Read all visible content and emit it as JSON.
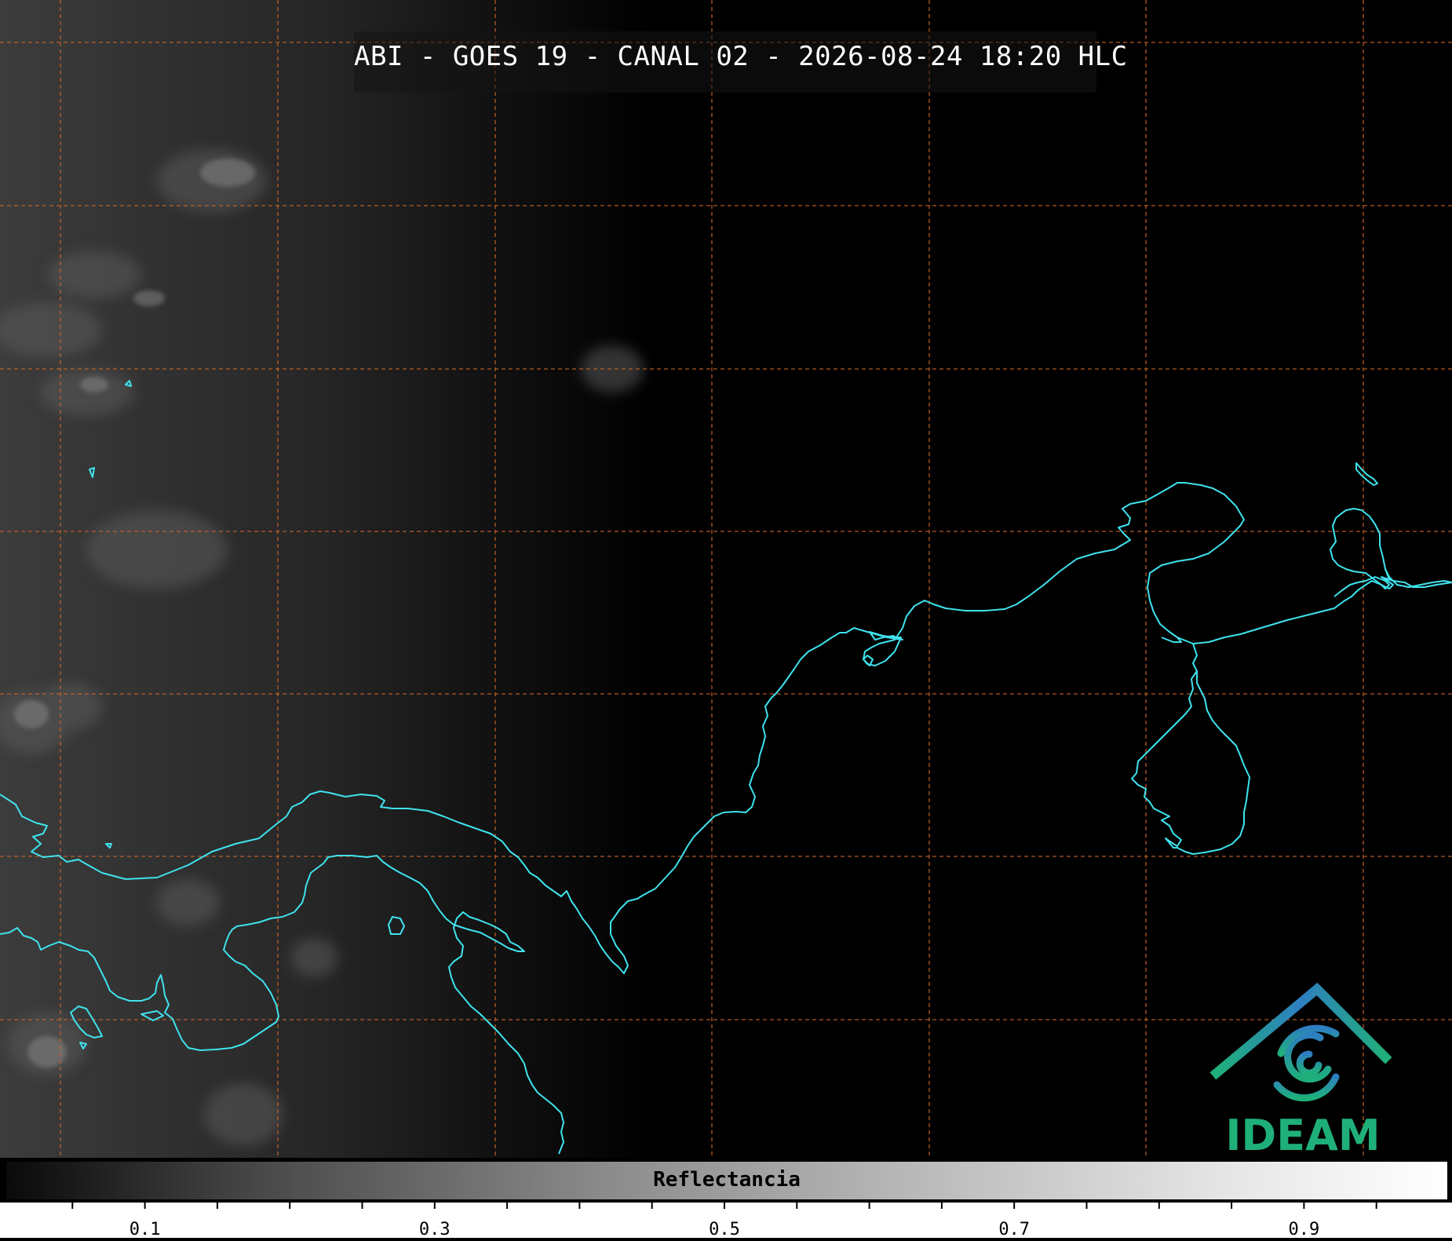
{
  "title": "ABI - GOES 19 - CANAL 02 - 2026-08-24 18:20 HLC",
  "colors": {
    "coastline": "#3fe3ee",
    "grid": "#c8642a",
    "logo_green": "#1fb07a",
    "logo_blue": "#2e7fc1"
  },
  "logo": {
    "text": "IDEAM",
    "icon": "ideam-logo-icon"
  },
  "colorbar": {
    "label": "Reflectancia",
    "range": [
      0,
      1
    ],
    "tick_labels": [
      "0.1",
      "0.3",
      "0.5",
      "0.7",
      "0.9"
    ],
    "tick_values": [
      0.1,
      0.3,
      0.5,
      0.7,
      0.9
    ]
  }
}
